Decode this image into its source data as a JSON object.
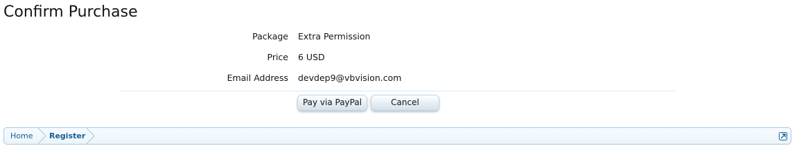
{
  "page": {
    "title": "Confirm Purchase"
  },
  "form": {
    "rows": [
      {
        "label": "Package",
        "value": "Extra Permission"
      },
      {
        "label": "Price",
        "value": "6 USD"
      },
      {
        "label": "Email Address",
        "value": "devdep9@vbvision.com"
      }
    ]
  },
  "buttons": {
    "pay_label": "Pay via PayPal",
    "cancel_label": "Cancel"
  },
  "breadcrumb": {
    "items": [
      {
        "label": "Home"
      },
      {
        "label": "Register"
      }
    ],
    "jump_icon": "external-jump-icon"
  },
  "colors": {
    "link": "#176093",
    "breadcrumb_border": "#a5cae4",
    "divider": "#d7edfc"
  }
}
